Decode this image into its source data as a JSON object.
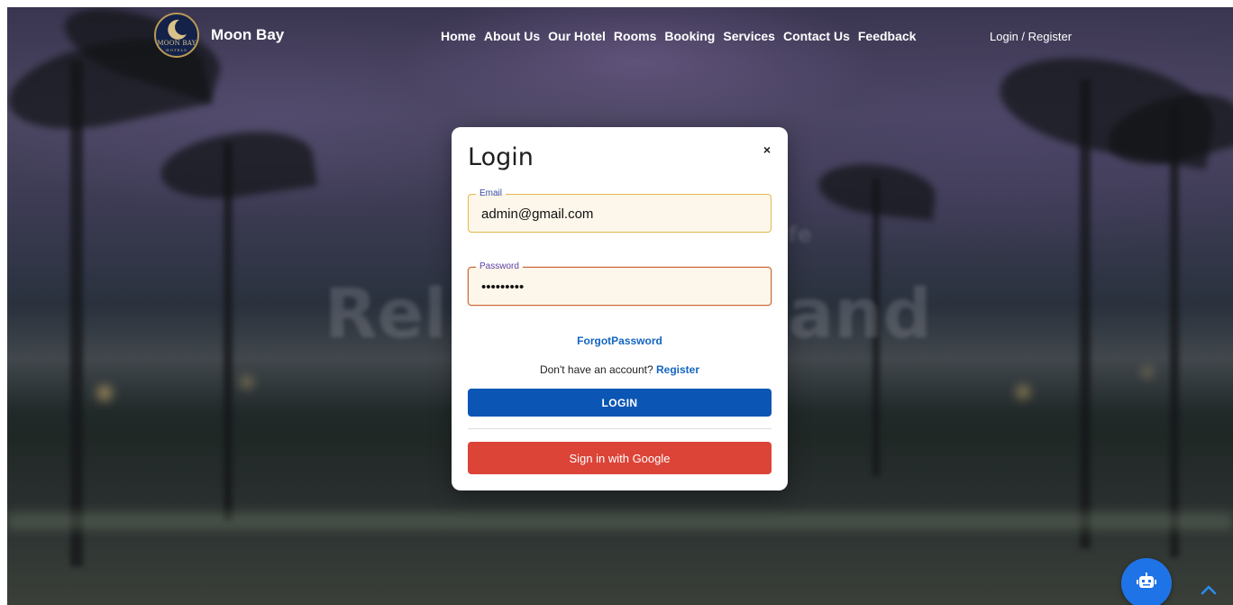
{
  "brand": {
    "logo_text": "MOON BAY",
    "logo_sub": "HOTELS",
    "name": "Moon Bay"
  },
  "nav": {
    "items": [
      "Home",
      "About Us",
      "Our Hotel",
      "Rooms",
      "Booking",
      "Services",
      "Contact Us",
      "Feedback"
    ],
    "login_register": "Login / Register"
  },
  "hero": {
    "text_left": "Rel",
    "text_right": "and",
    "small_right": "fe"
  },
  "modal": {
    "title": "Login",
    "close": "×",
    "email_label": "Email",
    "email_value": "admin@gmail.com",
    "password_label": "Password",
    "password_value": "•••••••••",
    "forgot": "ForgotPassword",
    "no_account": "Don't have an account? ",
    "register": "Register",
    "login_button": "LOGIN",
    "google_button": "Sign in with Google"
  },
  "colors": {
    "primary": "#0b56b4",
    "google": "#dc4438",
    "link": "#1565c0",
    "chat_fab": "#1e74e6"
  },
  "icons": {
    "chatbot": "robot-icon",
    "scroll_top": "chevron-up-icon",
    "close": "close-icon"
  }
}
